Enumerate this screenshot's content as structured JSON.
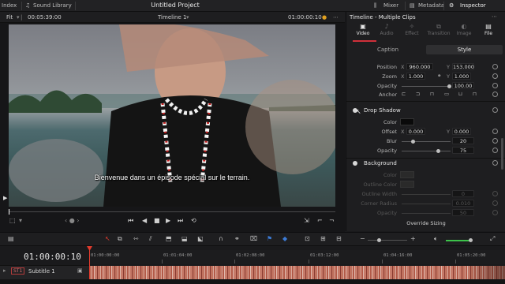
{
  "topbar": {
    "index_label": "Index",
    "sound_library_label": "Sound Library",
    "app_title": "Untitled Project",
    "mixer_label": "Mixer",
    "metadata_label": "Metadata",
    "inspector_label": "Inspector"
  },
  "viewer": {
    "zoom": "Fit",
    "source_timecode": "00:05:39:00",
    "timeline_name": "Timeline 1",
    "record_timecode": "01:00:00:10",
    "subtitle": "Bienvenue dans un épisode spécial sur le terrain."
  },
  "inspector": {
    "title": "Timeline - Multiple Clips",
    "tabs": [
      {
        "label": "Video",
        "icon": "video-icon",
        "active": true
      },
      {
        "label": "Audio",
        "icon": "audio-icon",
        "active": false
      },
      {
        "label": "Effect",
        "icon": "effect-icon",
        "active": false
      },
      {
        "label": "Transition",
        "icon": "transition-icon",
        "active": false
      },
      {
        "label": "Image",
        "icon": "image-icon",
        "active": false
      },
      {
        "label": "File",
        "icon": "file-icon",
        "active": false
      }
    ],
    "subtabs": {
      "caption": "Caption",
      "style": "Style"
    },
    "position": {
      "label": "Position",
      "x_axis": "X",
      "x": "960.000",
      "y_axis": "Y",
      "y": "153.000"
    },
    "zoom": {
      "label": "Zoom",
      "x_axis": "X",
      "x": "1.000",
      "y_axis": "Y",
      "y": "1.000"
    },
    "opacity": {
      "label": "Opacity",
      "value": "100.00",
      "level": 1.0
    },
    "anchor": {
      "label": "Anchor"
    },
    "drop_shadow": {
      "title": "Drop Shadow",
      "color_label": "Color",
      "offset_label": "Offset",
      "offset_x_axis": "X",
      "offset_x": "0.000",
      "offset_y_axis": "Y",
      "offset_y": "0.000",
      "blur_label": "Blur",
      "blur": "20",
      "blur_level": 0.2,
      "opacity_label": "Opacity",
      "opacity": "75",
      "opacity_level": 0.75
    },
    "background": {
      "title": "Background",
      "color_label": "Color",
      "outline_color_label": "Outline Color",
      "outline_width_label": "Outline Width",
      "outline_width": "0",
      "corner_radius_label": "Corner Radius",
      "corner_radius": "0.010",
      "opacity_label": "Opacity",
      "opacity": "50"
    },
    "override_sizing": "Override Sizing"
  },
  "timeline": {
    "current_timecode": "01:00:00:10",
    "ruler": [
      "01:00:00:00",
      "01:01:04:00",
      "01:02:08:00",
      "01:03:12:00",
      "01:04:16:00",
      "01:05:20:00"
    ],
    "track_badge": "ST1",
    "track_name": "Subtitle 1"
  },
  "colors": {
    "accent": "#d0303a",
    "playhead": "#e23b2d",
    "subtitle_clip": "#c0725f"
  }
}
